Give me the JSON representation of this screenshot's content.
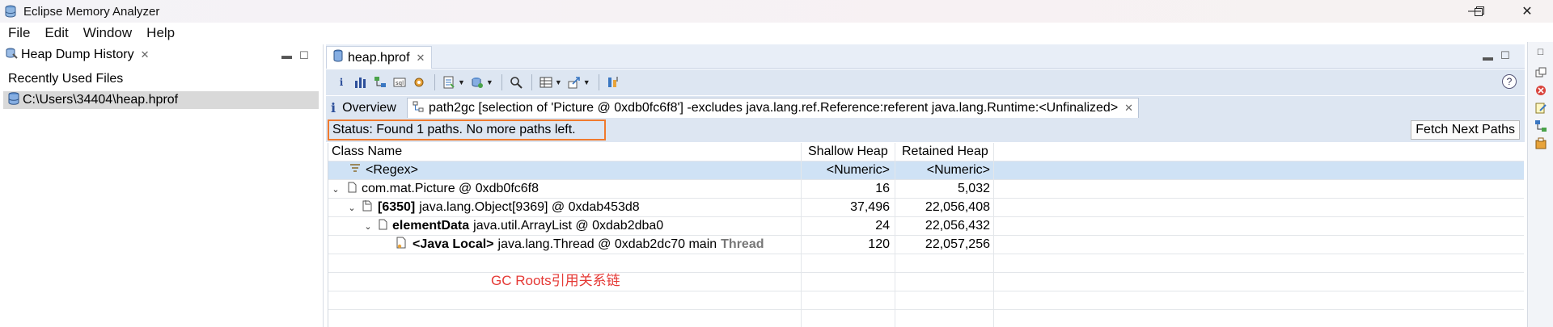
{
  "window": {
    "title": "Eclipse Memory Analyzer",
    "controls": {
      "minimize": "—",
      "maximize": "❐",
      "close": "✕"
    }
  },
  "menu": [
    "File",
    "Edit",
    "Window",
    "Help"
  ],
  "left_panel": {
    "tab_label": "Heap Dump History",
    "section_label": "Recently Used Files",
    "files": [
      "C:\\Users\\34404\\heap.hprof"
    ]
  },
  "editor": {
    "tab_label": "heap.hprof",
    "subtabs": {
      "overview": "Overview",
      "query": "path2gc  [selection of 'Picture @ 0xdb0fc6f8'] -excludes java.lang.ref.Reference:referent java.lang.Runtime:<Unfinalized>"
    },
    "status_text": "Status:  Found 1 paths. No more paths left.",
    "fetch_button": "Fetch Next Paths",
    "columns": [
      "Class Name",
      "Shallow Heap",
      "Retained Heap"
    ],
    "filter_row": {
      "name": "<Regex>",
      "shallow": "<Numeric>",
      "retained": "<Numeric>"
    },
    "rows": [
      {
        "prefix": "",
        "name": "com.mat.Picture @ 0xdb0fc6f8",
        "suffix": "",
        "shallow": "16",
        "retained": "5,032"
      },
      {
        "prefix": "[6350]",
        "name": "java.lang.Object[9369] @ 0xdab453d8",
        "suffix": "",
        "shallow": "37,496",
        "retained": "22,056,408"
      },
      {
        "prefix": "elementData",
        "name": "java.util.ArrayList @ 0xdab2dba0",
        "suffix": "",
        "shallow": "24",
        "retained": "22,056,432"
      },
      {
        "prefix": "<Java Local>",
        "name": "java.lang.Thread @ 0xdab2dc70  main",
        "suffix": "Thread",
        "shallow": "120",
        "retained": "22,057,256"
      }
    ],
    "annotation": "GC Roots引用关系链"
  },
  "colors": {
    "status_highlight": "#f07a2e",
    "annotation": "#e53935",
    "filter_row_bg": "#cfe2f5",
    "toolbar_bg": "#dde6f2"
  }
}
